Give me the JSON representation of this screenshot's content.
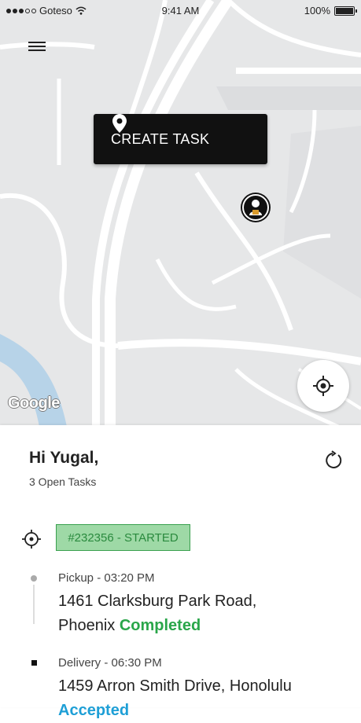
{
  "status_bar": {
    "carrier": "Goteso",
    "time": "9:41 AM",
    "battery": "100%"
  },
  "map": {
    "create_task_label": "CREATE TASK",
    "attribution": "Google"
  },
  "sheet": {
    "greeting": "Hi Yugal,",
    "open_tasks": "3 Open Tasks",
    "task_badge": "#232356 - STARTED",
    "pickup": {
      "meta": "Pickup - 03:20 PM",
      "address_line1": "1461 Clarksburg Park Road,",
      "address_line2": "Phoenix",
      "status": "Completed"
    },
    "delivery": {
      "meta": "Delivery - 06:30 PM",
      "address_line1": "1459  Arron Smith Drive, Honolulu",
      "status": "Accepted"
    }
  },
  "colors": {
    "badge_bg": "#9ed9a6",
    "completed": "#2aa64a",
    "accepted": "#1e9fd6"
  }
}
